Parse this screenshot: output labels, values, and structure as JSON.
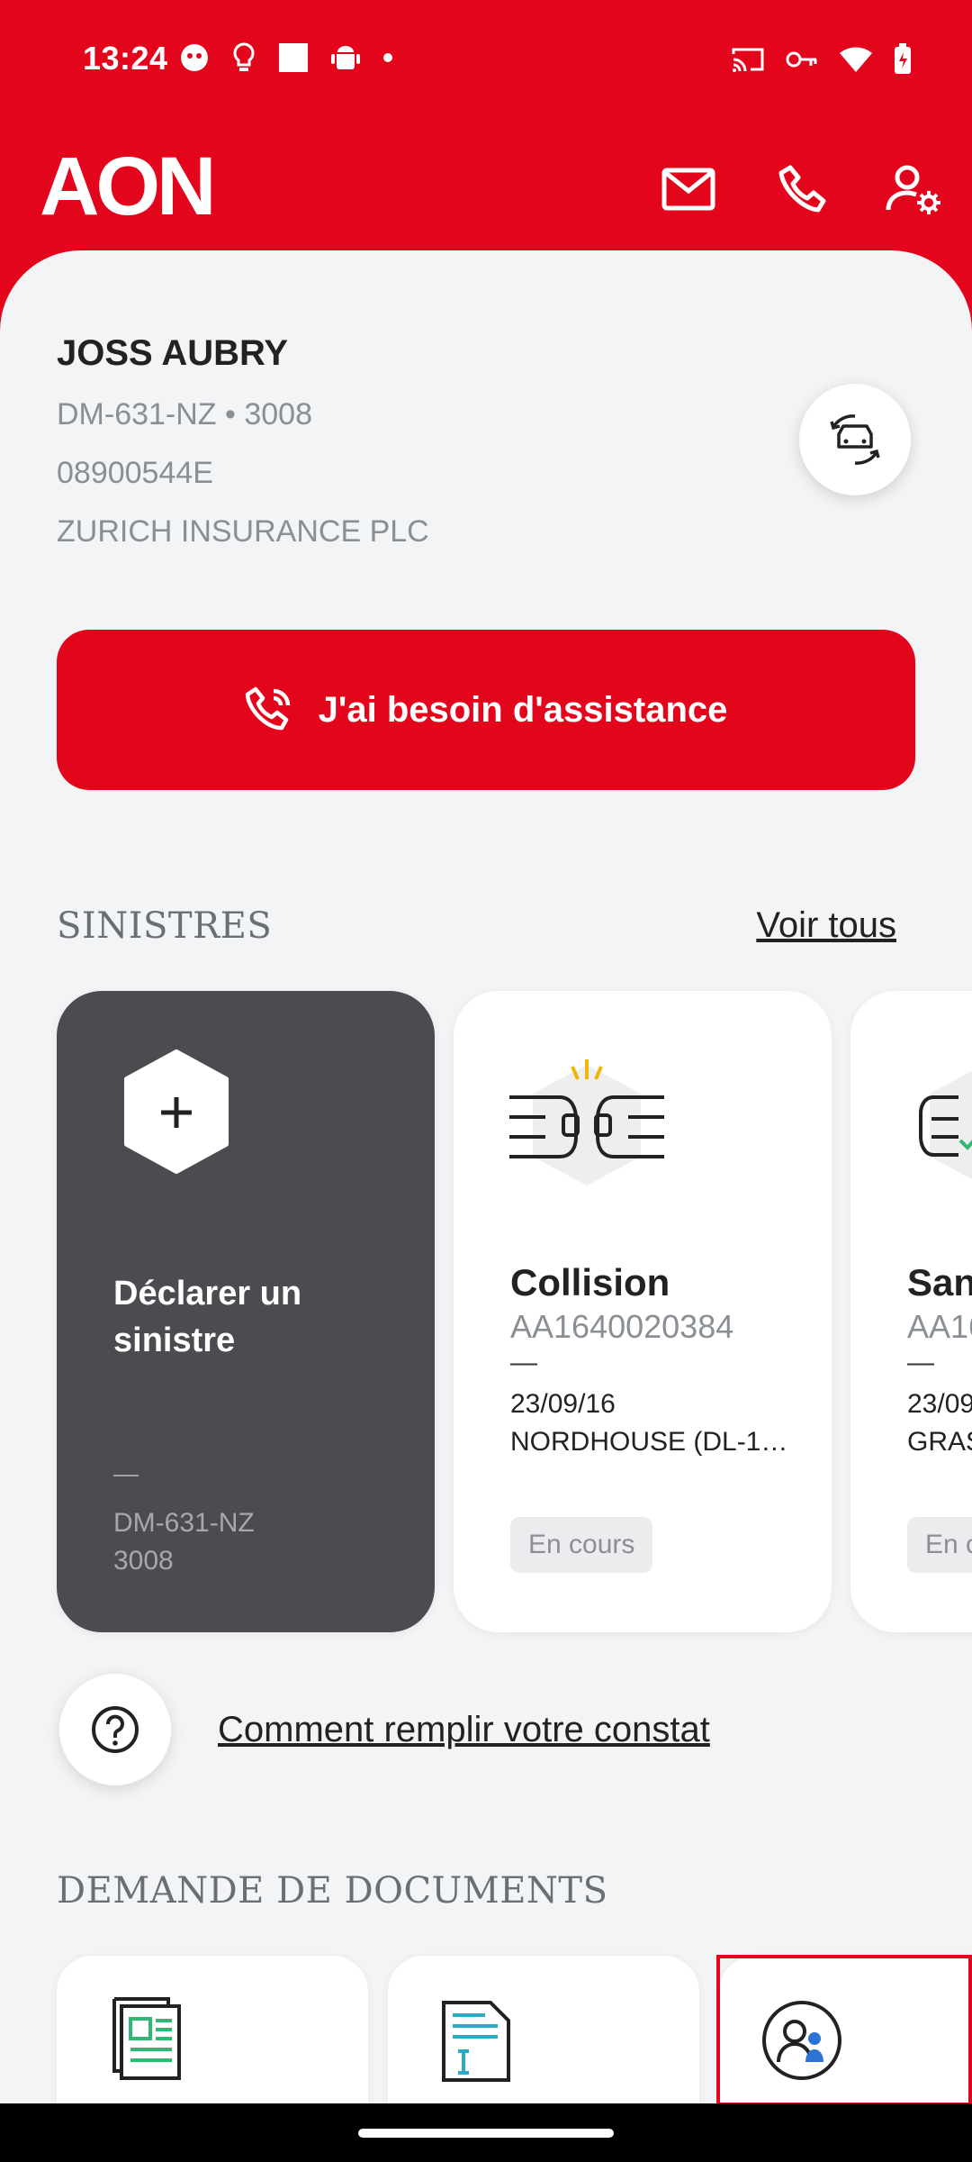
{
  "status_bar": {
    "time": "13:24"
  },
  "header": {
    "logo": "AON"
  },
  "profile": {
    "name": "JOSS AUBRY",
    "plate_line": "DM-631-NZ • 3008",
    "policy_number": "08900544E",
    "insurer": "ZURICH INSURANCE PLC"
  },
  "assist_button": {
    "label": "J'ai besoin d'assistance"
  },
  "claims_section": {
    "title": "SINISTRES",
    "see_all": "Voir tous",
    "declare": {
      "title": "Déclarer un sinistre",
      "dash": "—",
      "plate": "DM-631-NZ",
      "model": "3008"
    },
    "claims": [
      {
        "type": "Collision",
        "reference": "AA1640020384",
        "dash": "—",
        "date": "23/09/16",
        "location": "NORDHOUSE (DL-1…",
        "status": "En cours"
      },
      {
        "type": "San",
        "reference": "AA16",
        "dash": "—",
        "date": "23/09",
        "location": "GRAS",
        "status": "En c"
      }
    ]
  },
  "help": {
    "label": "Comment remplir votre constat"
  },
  "documents_section": {
    "title": "DEMANDE DE DOCUMENTS"
  },
  "colors": {
    "brand": "#e3051b",
    "dark_card": "#4b4c50",
    "background": "#f3f4f6"
  },
  "icons": [
    "mail-icon",
    "phone-icon",
    "user-settings-icon",
    "car-switch-icon",
    "phone-call-icon",
    "plus-hex-icon",
    "collision-icon",
    "help-icon",
    "document-icon",
    "contract-icon",
    "users-icon"
  ]
}
